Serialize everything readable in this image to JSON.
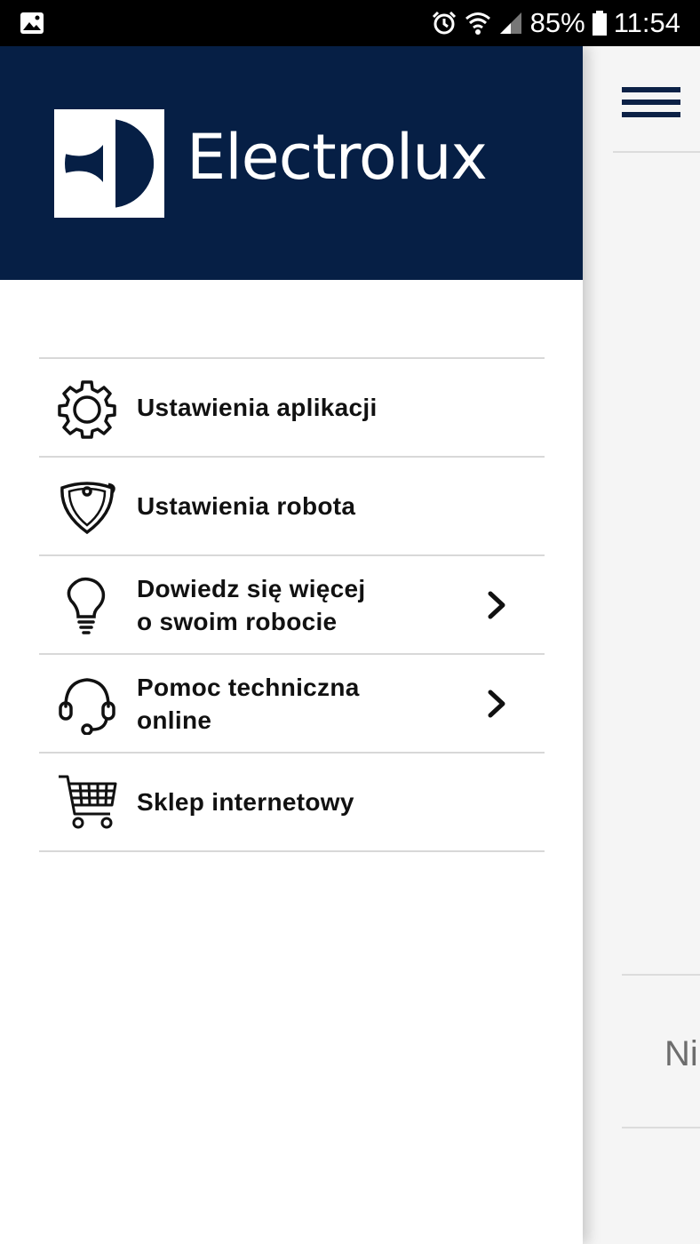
{
  "status_bar": {
    "battery_percent": "85%",
    "time": "11:54"
  },
  "brand": {
    "name": "Electrolux",
    "header_color": "#061f45"
  },
  "menu": {
    "items": [
      {
        "icon": "gear-icon",
        "line1": "Ustawienia aplikacji",
        "line2": "",
        "has_chevron": false
      },
      {
        "icon": "robot-icon",
        "line1": "Ustawienia robota",
        "line2": "",
        "has_chevron": false
      },
      {
        "icon": "lightbulb-icon",
        "line1": "Dowiedz się więcej",
        "line2": "o swoim robocie",
        "has_chevron": true
      },
      {
        "icon": "headset-icon",
        "line1": "Pomoc techniczna",
        "line2": "online",
        "has_chevron": true
      },
      {
        "icon": "cart-icon",
        "line1": "Sklep internetowy",
        "line2": "",
        "has_chevron": false
      }
    ]
  },
  "background": {
    "partial_text": "Ni"
  }
}
